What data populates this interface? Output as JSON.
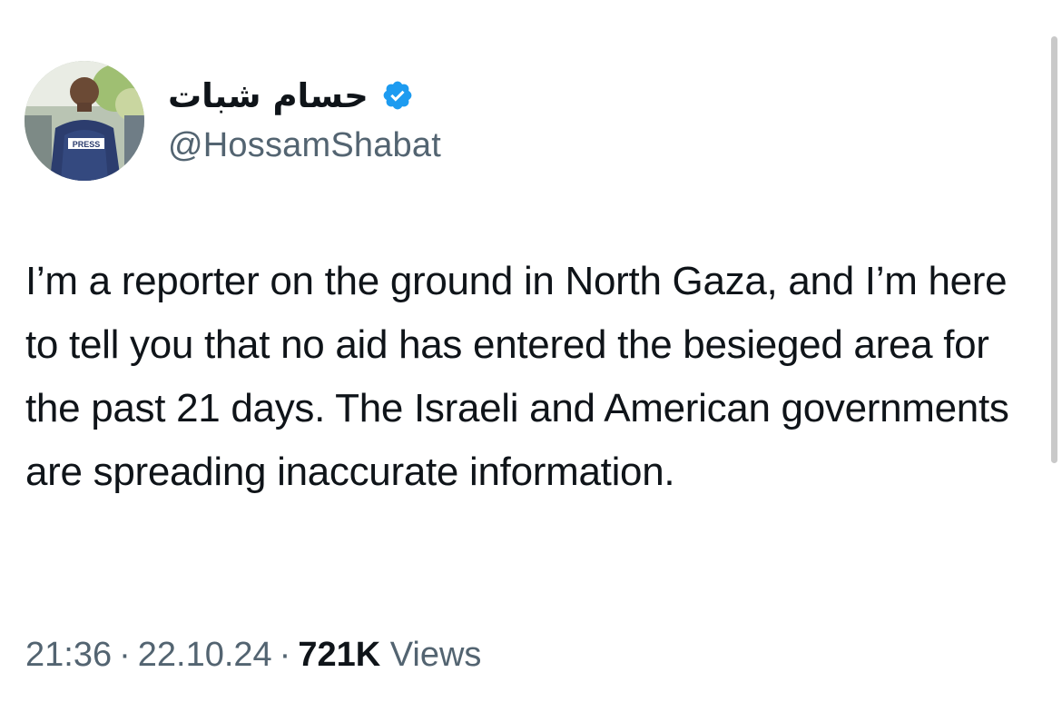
{
  "author": {
    "display_name": "حسام شبات",
    "handle": "@HossamShabat",
    "verified_icon": "verified-badge-icon",
    "avatar_icon": "profile-photo"
  },
  "avatar_vest_label": "PRESS",
  "tweet": {
    "text": "I’m a reporter on the ground in North Gaza, and I’m here to tell you that no aid has entered the besieged area for the past 21 days. The Israeli and American governments are spreading inaccurate information."
  },
  "meta": {
    "time": "21:36",
    "separator": "·",
    "date": "22.10.24",
    "views_count": "721K",
    "views_label": "Views"
  },
  "colors": {
    "verified_blue": "#1d9bf0",
    "text_primary": "#0f1419",
    "text_secondary": "#536471"
  }
}
